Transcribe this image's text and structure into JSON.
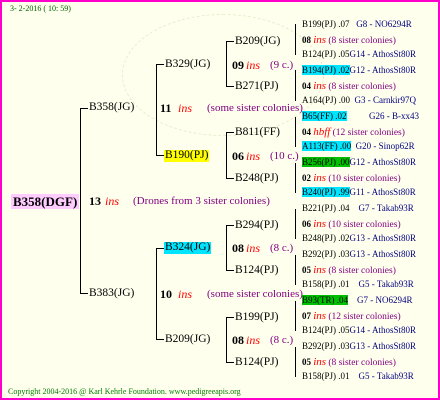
{
  "date_line": "3- 2-2016 ( 10: 59)",
  "copyright": "Copyright 2004-2016 @ Karl Kehrle Foundation.   www.pedigreeapis.org",
  "root": {
    "label": "B358(DGF)",
    "gen": "13",
    "ins": "ins",
    "note": "(Drones from 3 sister colonies)"
  },
  "g1": [
    {
      "label": "B358(JG)",
      "gen": "11",
      "ins": "ins",
      "note": "(some sister colonies)"
    },
    {
      "label": "B383(JG)",
      "gen": "10",
      "ins": "ins",
      "note": "(some sister colonies)"
    }
  ],
  "g2": [
    {
      "label": "B329(JG)",
      "gen": "09",
      "ins": "ins",
      "note": "(9 c.)"
    },
    {
      "label": "B190(PJ)",
      "gen": "06",
      "ins": "ins",
      "note": "(10 c.)"
    },
    {
      "label": "B324(JG)",
      "gen": "08",
      "ins": "ins",
      "note": "(8 c.)"
    },
    {
      "label": "B209(JG)",
      "gen": "08",
      "ins": "ins",
      "note": "(8 c.)"
    }
  ],
  "g3": [
    {
      "label": "B209(JG)",
      "gen": "08",
      "ins": "ins",
      "note": "(8 sister colonies)"
    },
    {
      "label": "B271(PJ)",
      "gen": "04",
      "ins": "ins",
      "note": "(8 sister colonies)"
    },
    {
      "label": "B811(FF)",
      "gen": "04",
      "ins": "hbff",
      "note": "(12 sister colonies)"
    },
    {
      "label": "B248(PJ)",
      "gen": "02",
      "ins": "ins",
      "note": "(10 sister colonies)"
    },
    {
      "label": "B294(PJ)",
      "gen": "06",
      "ins": "ins",
      "note": "(10 sister colonies)"
    },
    {
      "label": "B124(PJ)",
      "gen": "05",
      "ins": "ins",
      "note": "(8 sister colonies)"
    },
    {
      "label": "B199(PJ)",
      "gen": "07",
      "ins": "ins",
      "note": "(12 sister colonies)"
    },
    {
      "label": "B124(PJ)",
      "gen": "05",
      "ins": "ins",
      "note": "(8 sister colonies)"
    }
  ],
  "leaves": [
    {
      "label": "B199(PJ) .07",
      "code": "G8 - NO6294R"
    },
    {
      "label": "B124(PJ) .05",
      "code": "G14 - AthosSt80R"
    },
    {
      "label": "B194(PJ) .02",
      "code": "G12 - AthosSt80R"
    },
    {
      "label": "A164(PJ) .00",
      "code": "G3 - Carnkir97Q"
    },
    {
      "label": "B65(FF) .02",
      "code": "G26 - B-xx43"
    },
    {
      "label": "A113(FF) .00",
      "code": "G20 - Sinop62R"
    },
    {
      "label": "B256(PJ) .00",
      "code": "G12 - AthosSt80R"
    },
    {
      "label": "B240(PJ) .99",
      "code": "G11 - AthosSt80R"
    },
    {
      "label": "B221(PJ) .04",
      "code": "G7 - Takab93R"
    },
    {
      "label": "B248(PJ) .02",
      "code": "G13 - AthosSt80R"
    },
    {
      "label": "B292(PJ) .03",
      "code": "G13 - AthosSt80R"
    },
    {
      "label": "B158(PJ) .01",
      "code": "G5 - Takab93R"
    },
    {
      "label": "B93(TR) .04",
      "code": "G7 - NO6294R"
    },
    {
      "label": "B124(PJ) .05",
      "code": "G14 - AthosSt80R"
    },
    {
      "label": "B292(PJ) .03",
      "code": "G13 - AthosSt80R"
    },
    {
      "label": "B158(PJ) .01",
      "code": "G5 - Takab93R"
    }
  ]
}
